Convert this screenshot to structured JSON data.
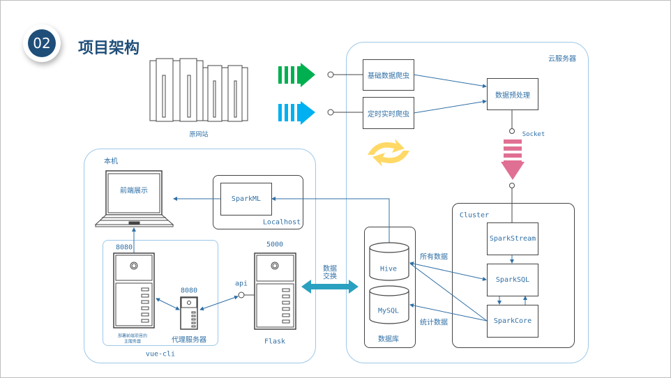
{
  "header": {
    "number": "02",
    "title": "项目架构"
  },
  "colors": {
    "title": "#1f4e79",
    "text": "#2f6fa5",
    "green_arrow": "#00b050",
    "blue_arrow": "#00b0f0",
    "pink_arrow": "#e07093",
    "exchange_arrow": "#2aa0c0",
    "refresh_icon": "#ffd966"
  },
  "source": {
    "label": "原网站"
  },
  "cloud": {
    "label": "云服务器",
    "crawler_basic": "基础数据爬虫",
    "crawler_realtime": "定时实时爬虫",
    "preprocess": "数据预处理",
    "socket": "Socket",
    "cluster": {
      "label": "Cluster",
      "stream": "SparkStream",
      "sql": "SparkSQL",
      "core": "SparkCore"
    },
    "database": {
      "label": "数据库",
      "hive": "Hive",
      "mysql": "MySQL"
    },
    "all_data": "所有数据",
    "stat_data": "统计数据"
  },
  "exchange": {
    "line1": "数据",
    "line2": "交换"
  },
  "local": {
    "label": "本机",
    "frontend": "前端展示",
    "localhost": {
      "label": "Localhost",
      "sparkml": "SparkML"
    },
    "vuecli": {
      "label": "vue-cli",
      "main_port": "8080",
      "main_caption_1": "部署前端项目的",
      "main_caption_2": "主服务器",
      "proxy_port": "8080",
      "proxy_label": "代理服务器"
    },
    "flask": {
      "port": "5000",
      "label": "Flask",
      "api": "api"
    }
  }
}
